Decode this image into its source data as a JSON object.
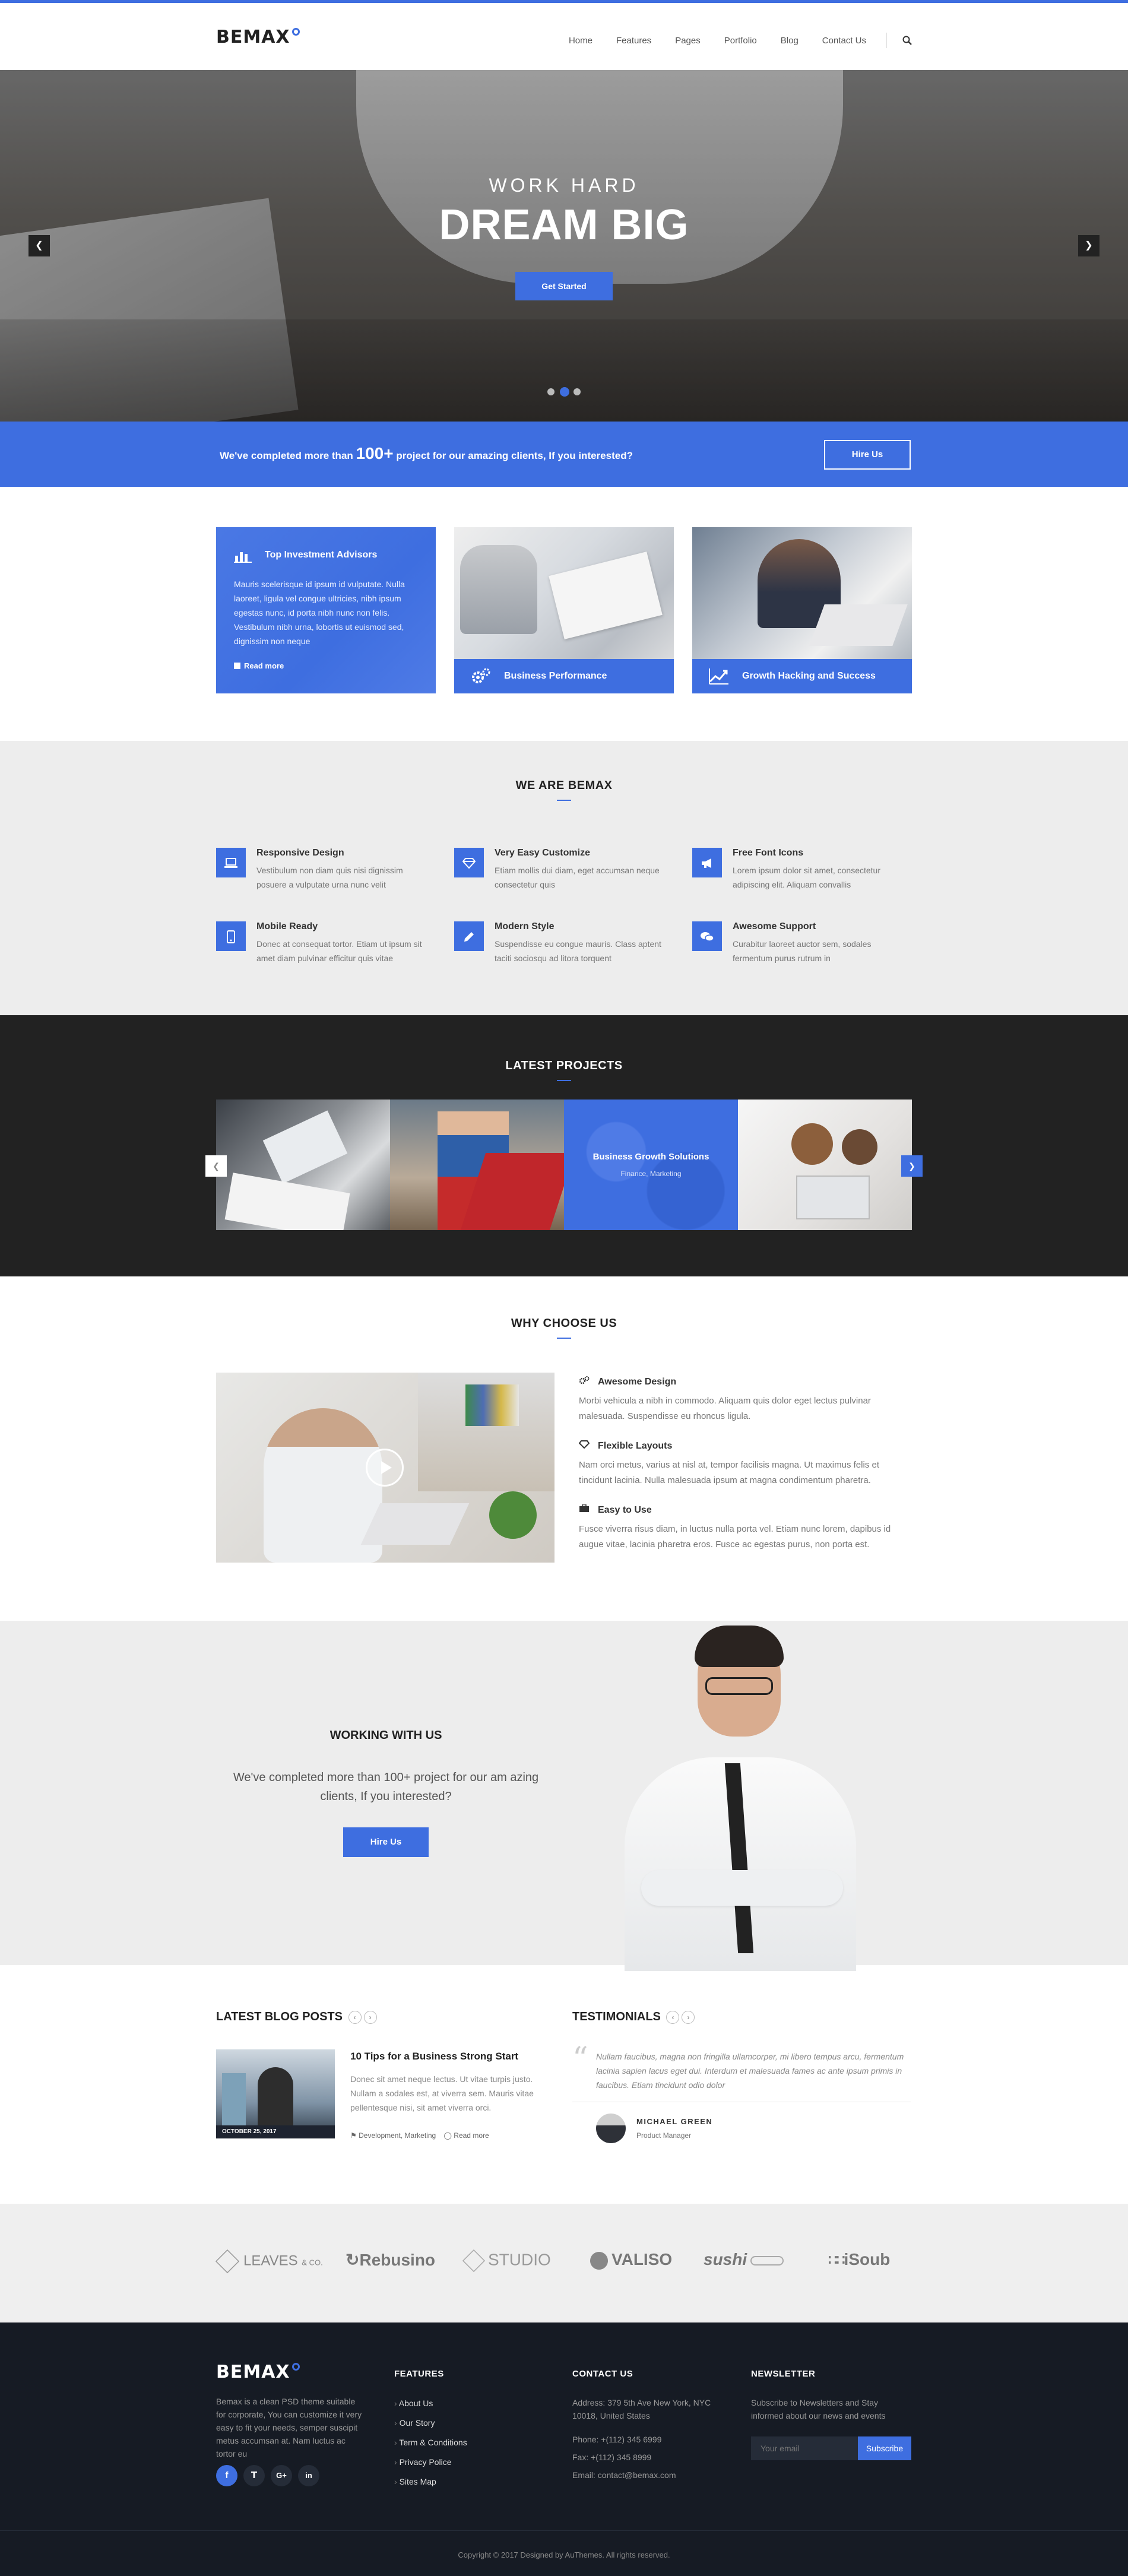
{
  "header": {
    "logo": "BEMAX",
    "nav": [
      "Home",
      "Features",
      "Pages",
      "Portfolio",
      "Blog",
      "Contact Us"
    ]
  },
  "hero": {
    "subtitle": "WORK HARD",
    "title": "DREAM BIG",
    "cta": "Get Started"
  },
  "band": {
    "text_before": "We've completed more than",
    "highlight": "100+",
    "text_after": "project for our amazing clients, If you interested?",
    "button": "Hire Us"
  },
  "cards": [
    {
      "title": "Top Investment Advisors",
      "text": "Mauris scelerisque id ipsum id vulputate. Nulla laoreet, ligula vel congue ultricies, nibh ipsum egestas nunc, id porta nibh nunc non felis. Vestibulum nibh urna, lobortis ut euismod sed, dignissim non neque",
      "link": "Read more"
    },
    {
      "title": "Business Performance"
    },
    {
      "title": "Growth Hacking and Success"
    }
  ],
  "about": {
    "title": "WE ARE BEMAX",
    "features": [
      {
        "title": "Responsive Design",
        "text": "Vestibulum non diam quis nisi dignissim posuere a vulputate urna nunc velit"
      },
      {
        "title": "Very Easy Customize",
        "text": "Etiam mollis dui diam, eget accumsan neque consectetur quis"
      },
      {
        "title": "Free Font Icons",
        "text": "Lorem ipsum dolor sit amet, consectetur adipiscing elit. Aliquam convallis"
      },
      {
        "title": "Mobile Ready",
        "text": "Donec at consequat tortor. Etiam ut ipsum sit amet diam pulvinar efficitur quis vitae"
      },
      {
        "title": "Modern Style",
        "text": "Suspendisse eu congue mauris. Class aptent taciti sociosqu ad litora torquent"
      },
      {
        "title": "Awesome Support",
        "text": "Curabitur laoreet auctor sem, sodales fermentum purus rutrum in"
      }
    ]
  },
  "projects": {
    "title": "LATEST PROJECTS",
    "featured_title": "Business Growth Solutions",
    "featured_tags": "Finance, Marketing"
  },
  "why": {
    "title": "WHY CHOOSE US",
    "items": [
      {
        "title": "Awesome Design",
        "text": "Morbi vehicula a nibh in commodo. Aliquam quis dolor eget lectus pulvinar malesuada. Suspendisse eu rhoncus ligula."
      },
      {
        "title": "Flexible Layouts",
        "text": "Nam orci metus, varius at nisl at, tempor facilisis magna. Ut maximus felis et tincidunt lacinia. Nulla malesuada ipsum at magna condimentum pharetra."
      },
      {
        "title": "Easy to Use",
        "text": "Fusce viverra risus diam, in luctus nulla porta vel. Etiam nunc lorem, dapibus id augue vitae, lacinia pharetra eros. Fusce ac egestas purus, non porta est."
      }
    ]
  },
  "working": {
    "title": "WORKING WITH US",
    "text": "We've completed more than 100+ project for our am azing clients, If you interested?",
    "button": "Hire Us"
  },
  "blog": {
    "title": "LATEST BLOG POSTS",
    "post_title": "10 Tips for a Business Strong Start",
    "post_text": "Donec sit amet neque lectus. Ut vitae turpis justo. Nullam a sodales est, at viverra sem. Mauris vitae pellentesque nisi, sit amet viverra orci.",
    "date": "OCTOBER 25, 2017",
    "tags": "Development, Marketing",
    "read_more": "Read more"
  },
  "testimonials": {
    "title": "TESTIMONIALS",
    "quote": "Nullam faucibus, magna non fringilla ullamcorper, mi libero tempus arcu, fermentum lacinia sapien lacus eget dui. Interdum et malesuada fames ac ante ipsum primis in faucibus. Etiam tincidunt odio dolor",
    "name": "MICHAEL GREEN",
    "role": "Product Manager"
  },
  "partners": [
    "LEAVES",
    "& CO.",
    "Rebusino",
    "STUDIO",
    "VALISO",
    "sushi",
    "iSoub"
  ],
  "footer": {
    "logo": "BEMAX",
    "about": "Bemax is a clean PSD theme suitable for corporate, You can customize it very easy to fit your needs, semper suscipit metus accumsan at. Nam luctus ac tortor eu",
    "features_title": "FEATURES",
    "links": [
      "About Us",
      "Our Story",
      "Term & Conditions",
      "Privacy Police",
      "Sites Map"
    ],
    "contact_title": "CONTACT US",
    "address": "Address: 379 5th Ave  New York, NYC 10018, United States",
    "phone": "Phone: +(112) 345 6999",
    "fax": "Fax: +(112) 345 8999",
    "email": "Email: contact@bemax.com",
    "newsletter_title": "NEWSLETTER",
    "newsletter_text": "Subscribe to Newsletters and Stay informed about our news and events",
    "email_placeholder": "Your email",
    "subscribe": "Subscribe",
    "copyright": "Copyright © 2017 Designed by AuThemes. All rights reserved."
  },
  "colors": {
    "accent": "#3e6ee0",
    "dark": "#222222",
    "footer": "#161b24",
    "gray": "#ededed"
  }
}
